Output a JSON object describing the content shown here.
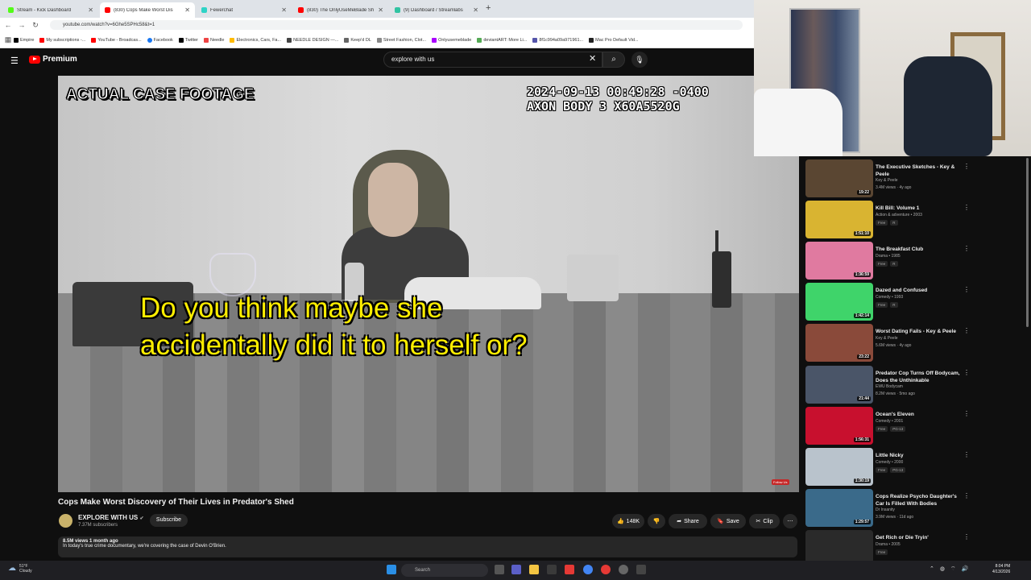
{
  "browser": {
    "tabs": [
      {
        "title": "Stream - Kick Dashboard",
        "color": "#53fc18"
      },
      {
        "title": "(830) Cops Make Worst Dis",
        "color": "#ff0000"
      },
      {
        "title": "Fewerchat",
        "color": "#2ed3c6"
      },
      {
        "title": "(830) The OnlyUseMeBlade Sh",
        "color": "#ff0000"
      },
      {
        "title": "(9) Dashboard / Streamlabs",
        "color": "#31c3a2"
      }
    ],
    "url": "youtube.com/watch?v=6Ghe5SPHc58&t=1",
    "bookmarks": [
      "Empire",
      "My subscriptions -...",
      "YouTube - Broadcas...",
      "Facebook",
      "Twitter",
      "Needle",
      "Electronics, Cars, Fa...",
      "NEEDLE DESIGN —...",
      "Keep'd DL",
      "Street Fashion, Clot...",
      "Onlyusemeblade",
      "deviantART: More Li...",
      "8f1c994a09a971961...",
      "Mac Pro Default Vid..."
    ]
  },
  "yt": {
    "logo": "Premium",
    "search": "explore with us"
  },
  "video": {
    "banner": "ACTUAL CASE FOOTAGE",
    "stamp_line1": "2024-09-13 00:49:28 -0400",
    "stamp_line2": "AXON BODY 3 X60A5520G",
    "subtitle_line1": "Do you think maybe she",
    "subtitle_line2": "accidentally did it to herself or?",
    "follow_label": "Follow Us"
  },
  "info": {
    "title": "Cops Make Worst Discovery of Their Lives in Predator's Shed",
    "channel": "EXPLORE WITH US",
    "subscribers": "7.37M subscribers",
    "subscribe": "Subscribe",
    "likes": "148K",
    "share": "Share",
    "save": "Save",
    "clip": "Clip",
    "views": "8.5M views  1 month ago",
    "description": "In today's true crime documentary, we're covering the case of Devin O'Brien."
  },
  "recommendations": [
    {
      "title": "The Executive Sketches - Key & Peele",
      "line1": "Key & Peele",
      "line2": "3.4M views · 4y ago",
      "tags": [],
      "duration": "19:22",
      "thumb": "#5a4632"
    },
    {
      "title": "Kill Bill: Volume 1",
      "line1": "Action & adventure • 2003",
      "line2": "",
      "tags": [
        "Free",
        "R"
      ],
      "duration": "1:51:10",
      "thumb": "#d9b431"
    },
    {
      "title": "The Breakfast Club",
      "line1": "Drama • 1985",
      "line2": "",
      "tags": [
        "Free",
        "R"
      ],
      "duration": "1:36:59",
      "thumb": "#e07aa0"
    },
    {
      "title": "Dazed and Confused",
      "line1": "Comedy • 1993",
      "line2": "",
      "tags": [
        "Free",
        "R"
      ],
      "duration": "1:42:14",
      "thumb": "#3fd46a"
    },
    {
      "title": "Worst Dating Fails - Key & Peele",
      "line1": "Key & Peele",
      "line2": "5.6M views · 4y ago",
      "tags": [],
      "duration": "23:22",
      "thumb": "#8a4a3a"
    },
    {
      "title": "Predator Cop Turns Off Bodycam, Does the Unthinkable",
      "line1": "EWU Bodycam",
      "line2": "8.2M views · 5mo ago",
      "tags": [],
      "duration": "21:44",
      "thumb": "#4a5568"
    },
    {
      "title": "Ocean's Eleven",
      "line1": "Comedy • 2001",
      "line2": "",
      "tags": [
        "Free",
        "PG-13"
      ],
      "duration": "1:56:31",
      "thumb": "#c8102e"
    },
    {
      "title": "Little Nicky",
      "line1": "Comedy • 2000",
      "line2": "",
      "tags": [
        "Free",
        "PG-13"
      ],
      "duration": "1:30:19",
      "thumb": "#b9c3cc"
    },
    {
      "title": "Cops Realize Psycho Daughter's Car Is Filled With Bodies",
      "line1": "Dr Insanity",
      "line2": "3.9M views · 11d ago",
      "tags": [],
      "duration": "1:29:57",
      "thumb": "#3a6a8a"
    },
    {
      "title": "Get Rich or Die Tryin'",
      "line1": "Drama • 2005",
      "line2": "",
      "tags": [
        "Free"
      ],
      "duration": "",
      "thumb": "#2a2a2a"
    }
  ],
  "taskbar": {
    "temp": "51°F",
    "condition": "Cloudy",
    "search": "Search",
    "time": "8:04 PM",
    "date": "4/13/2026"
  }
}
